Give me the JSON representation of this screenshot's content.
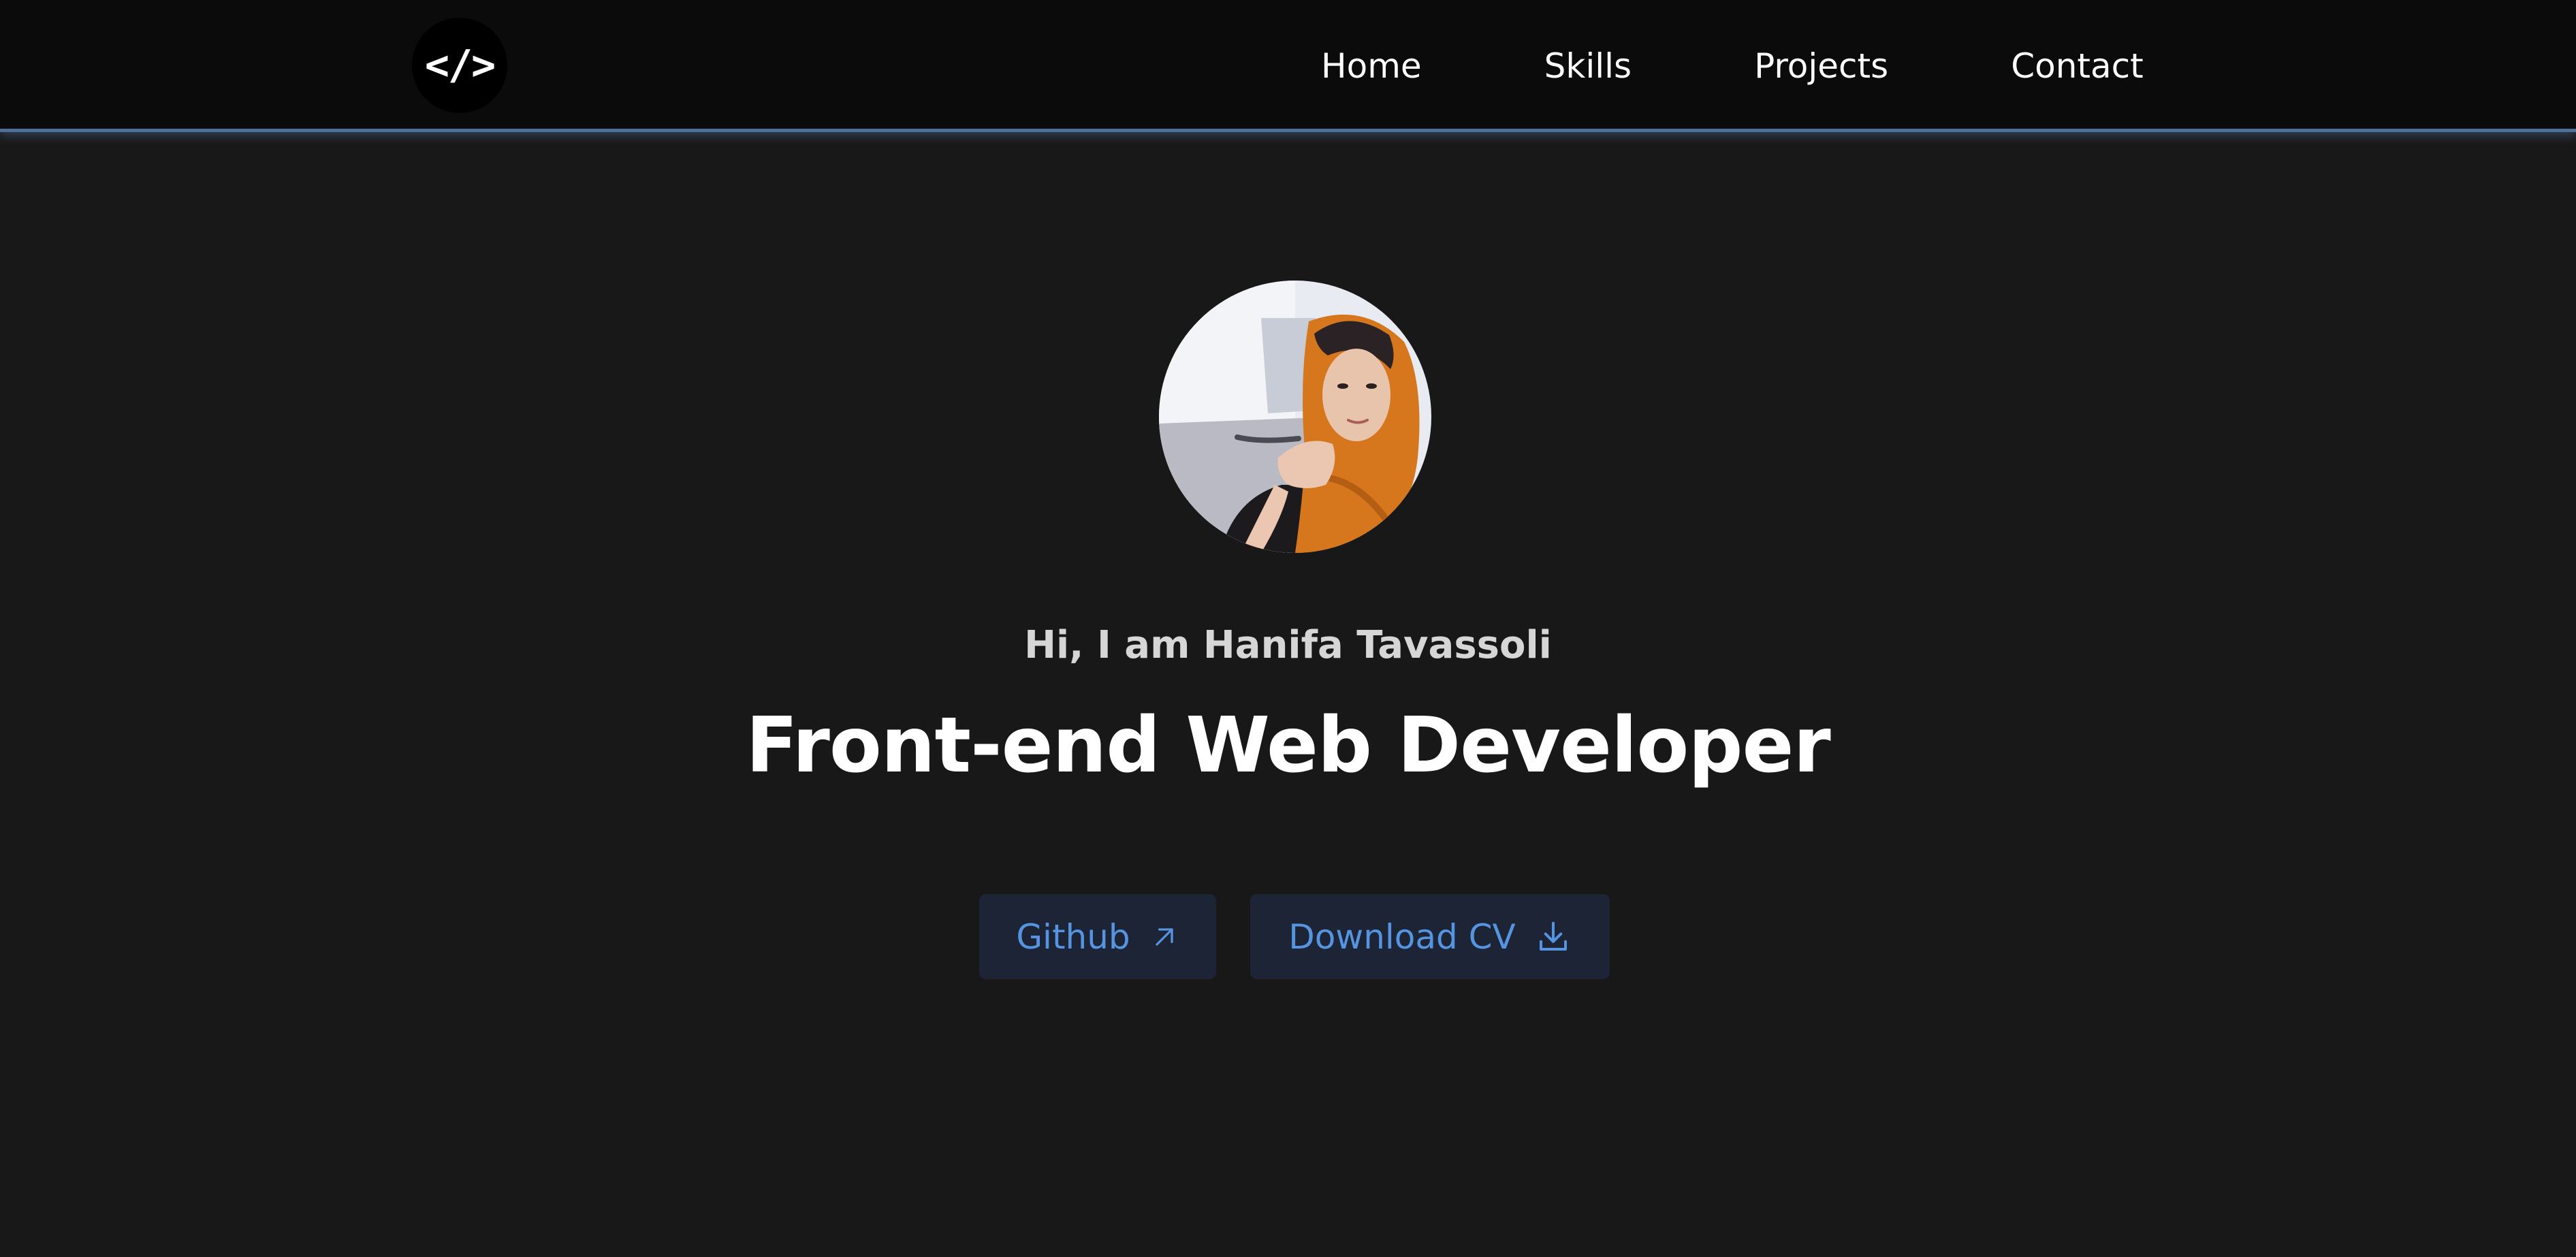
{
  "header": {
    "logo_text": "</>",
    "nav": [
      {
        "label": "Home"
      },
      {
        "label": "Skills"
      },
      {
        "label": "Projects"
      },
      {
        "label": "Contact"
      }
    ]
  },
  "hero": {
    "avatar_icon": "profile-photo",
    "greeting": "Hi, I am Hanifa Tavassoli",
    "title": "Front-end Web Developer",
    "buttons": {
      "github": {
        "label": "Github",
        "icon": "arrow-up-right-icon"
      },
      "cv": {
        "label": "Download CV",
        "icon": "download-icon"
      }
    }
  },
  "colors": {
    "background": "#181818",
    "navbar": "#0b0b0b",
    "accent": "#5594e0",
    "button_bg": "#1d2435",
    "nav_border": "#4f6f98"
  }
}
